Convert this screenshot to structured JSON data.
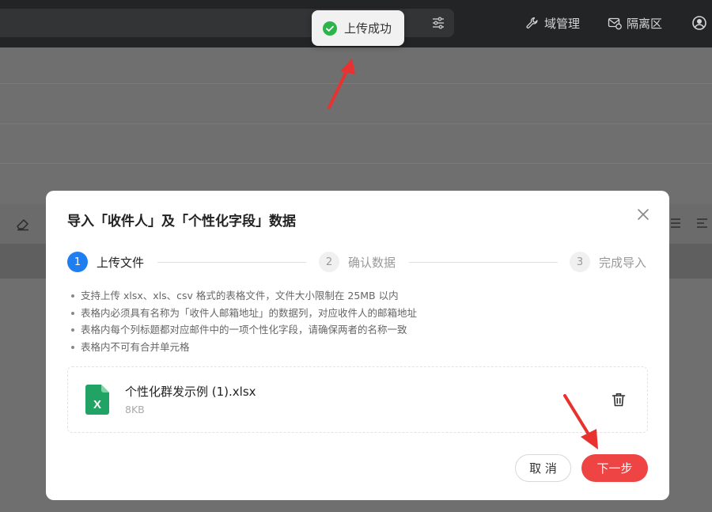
{
  "topbar": {
    "nav_domain": "域管理",
    "nav_quarantine": "隔离区",
    "icons": [
      "filter-icon",
      "wrench-icon",
      "mail-shield-icon",
      "user-avatar-icon"
    ]
  },
  "toast": {
    "text": "上传成功",
    "status_color": "#2cb34a"
  },
  "modal": {
    "title": "导入「收件人」及「个性化字段」数据",
    "steps": [
      {
        "number": "1",
        "label": "上传文件",
        "active": true
      },
      {
        "number": "2",
        "label": "确认数据",
        "active": false
      },
      {
        "number": "3",
        "label": "完成导入",
        "active": false
      }
    ],
    "rules": [
      "支持上传 xlsx、xls、csv 格式的表格文件，文件大小限制在 25MB 以内",
      "表格内必须具有名称为「收件人邮箱地址」的数据列，对应收件人的邮箱地址",
      "表格内每个列标题都对应邮件中的一项个性化字段，请确保两者的名称一致",
      "表格内不可有合并单元格"
    ],
    "file": {
      "name": "个性化群发示例 (1).xlsx",
      "size": "8KB",
      "icon_letter": "X"
    },
    "buttons": {
      "cancel": "取 消",
      "next": "下一步"
    }
  },
  "colors": {
    "accent_blue": "#1f7ef0",
    "primary_red": "#ef4444",
    "annotation_red": "#e8322f",
    "excel_green": "#21a366"
  }
}
